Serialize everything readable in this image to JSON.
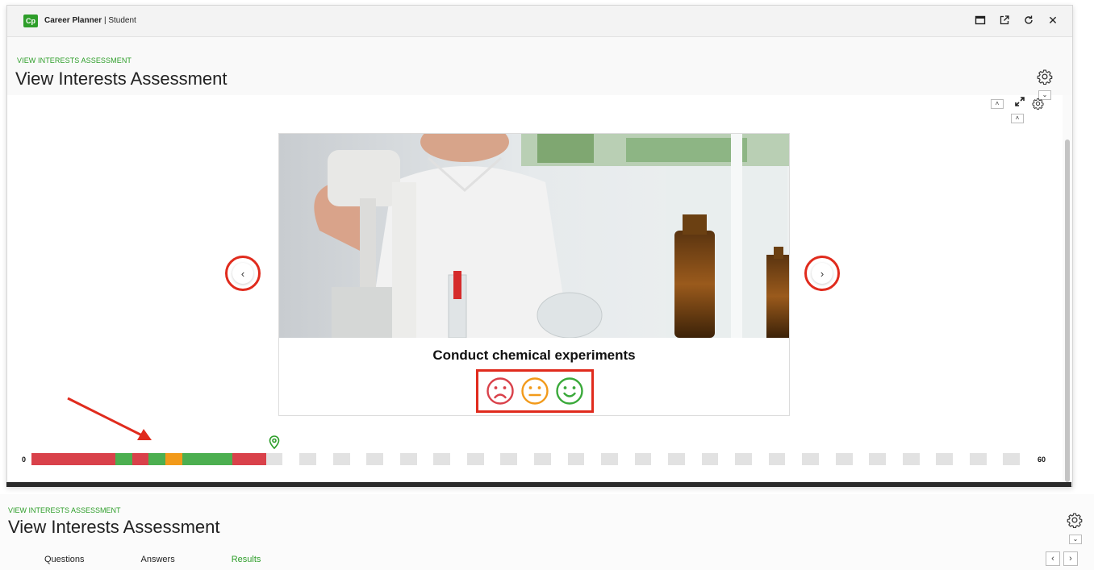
{
  "app": {
    "logo": "Cp",
    "name": "Career Planner",
    "separator": "|",
    "role": "Student"
  },
  "modal": {
    "breadcrumb": "VIEW INTERESTS ASSESSMENT",
    "title": "View Interests Assessment",
    "window_controls": [
      {
        "name": "maximize-icon"
      },
      {
        "name": "popout-icon"
      },
      {
        "name": "refresh-icon"
      },
      {
        "name": "close-icon",
        "glyph": "✕"
      }
    ]
  },
  "carousel": {
    "activity": "Conduct chemical experiments",
    "prev_glyph": "‹",
    "next_glyph": "›",
    "responses": [
      {
        "name": "dislike",
        "color": "#d9414a"
      },
      {
        "name": "neutral",
        "color": "#f29a1a"
      },
      {
        "name": "like",
        "color": "#3aa93a"
      }
    ]
  },
  "progress": {
    "min_label": "0",
    "max_label": "60",
    "total": 60,
    "answered": 14,
    "segments": [
      "r",
      "r",
      "r",
      "r",
      "r",
      "g",
      "r",
      "g",
      "o",
      "g",
      "g",
      "g",
      "r",
      "r",
      "e",
      "f",
      "e",
      "f",
      "e",
      "f",
      "e",
      "f",
      "e",
      "f",
      "e",
      "f",
      "e",
      "f",
      "e",
      "f",
      "e",
      "f",
      "e",
      "f",
      "e",
      "f",
      "e",
      "f",
      "e",
      "f",
      "e",
      "f",
      "e",
      "f",
      "e",
      "f",
      "e",
      "f",
      "e",
      "f",
      "e",
      "f",
      "e",
      "f",
      "e",
      "f",
      "e",
      "f",
      "e",
      "f"
    ],
    "colors": {
      "r": "#d9414a",
      "g": "#4caf50",
      "o": "#f29a1a",
      "e": "#e2e2e2",
      "f": "#ffffff"
    }
  },
  "bottom": {
    "breadcrumb": "VIEW INTERESTS ASSESSMENT",
    "title": "View Interests Assessment",
    "tabs": [
      {
        "label": "Questions"
      },
      {
        "label": "Answers"
      },
      {
        "label": "Results",
        "active": true
      }
    ]
  },
  "colors": {
    "accent": "#2e9e2a",
    "annotation": "#e02b1d"
  }
}
